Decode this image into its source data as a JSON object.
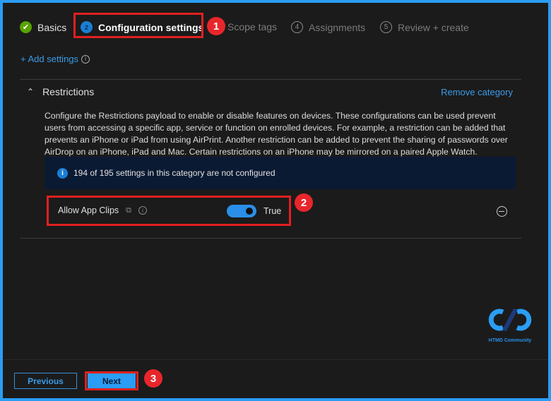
{
  "steps": [
    {
      "label": "Basics",
      "state": "complete"
    },
    {
      "label": "Configuration settings",
      "number": "2",
      "state": "current"
    },
    {
      "label": "Scope tags",
      "state": "pending"
    },
    {
      "label": "Assignments",
      "number": "4",
      "state": "pending"
    },
    {
      "label": "Review + create",
      "number": "5",
      "state": "pending"
    }
  ],
  "add_settings": "+ Add settings",
  "category": {
    "title": "Restrictions",
    "remove": "Remove category",
    "description": "Configure the Restrictions payload to enable or disable features on devices. These configurations can be used prevent users from accessing a specific app, service or function on enrolled devices. For example, a restriction can be added that prevents an iPhone or iPad from using AirPrint. Another restriction can be added to prevent the sharing of passwords over AirDrop on an iPhone, iPad and Mac. Certain restrictions on an iPhone may be mirrored on a paired Apple Watch.",
    "info": "194 of 195 settings in this category are not configured",
    "setting": {
      "label": "Allow App Clips",
      "value": "True",
      "enabled": true
    }
  },
  "callouts": [
    "1",
    "2",
    "3"
  ],
  "logo_text": "HTMD Community",
  "footer": {
    "previous": "Previous",
    "next": "Next"
  },
  "colors": {
    "accent": "#2a9df4",
    "callout": "#e8262b",
    "success": "#57a300"
  }
}
